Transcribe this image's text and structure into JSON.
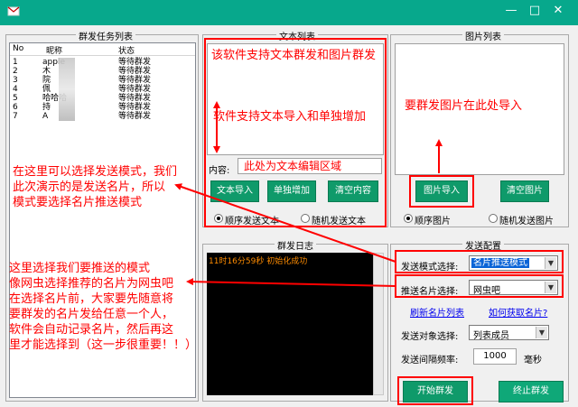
{
  "window": {
    "minimize": "—",
    "maximize": "□",
    "close": "✕"
  },
  "task_list": {
    "title": "群发任务列表",
    "columns": [
      "No",
      "昵称",
      "状态"
    ],
    "rows": [
      {
        "no": "1",
        "nick": "apple",
        "status": "等待群发"
      },
      {
        "no": "2",
        "nick": "木",
        "status": "等待群发"
      },
      {
        "no": "3",
        "nick": "院",
        "status": "等待群发"
      },
      {
        "no": "4",
        "nick": "佩",
        "status": "等待群发"
      },
      {
        "no": "5",
        "nick": "哈哈哈",
        "status": "等待群发"
      },
      {
        "no": "6",
        "nick": "持",
        "status": "等待群发"
      },
      {
        "no": "7",
        "nick": "A",
        "status": "等待群发"
      }
    ]
  },
  "text_list": {
    "title": "文本列表",
    "content": "该软件支持文本群发和图片群发",
    "content2": "软件支持文本导入和单独增加",
    "content_label": "内容:",
    "content_placeholder": "此处为文本编辑区域",
    "import_btn": "文本导入",
    "add_btn": "单独增加",
    "clear_btn": "清空内容",
    "radio_seq": "顺序发送文本",
    "radio_rand": "随机发送文本"
  },
  "image_list": {
    "title": "图片列表",
    "note": "要群发图片在此处导入",
    "import_btn": "图片导入",
    "clear_btn": "清空图片",
    "radio_seq": "顺序图片",
    "radio_rand": "随机发送图片"
  },
  "log": {
    "title": "群发日志",
    "entry": "11时16分59秒  初始化成功"
  },
  "config": {
    "title": "发送配置",
    "mode_label": "发送模式选择:",
    "mode_value": "名片推送模式",
    "card_label": "推送名片选择:",
    "card_value": "网虫吧",
    "refresh_link": "刷新名片列表",
    "howto_link": "如何获取名片?",
    "target_label": "发送对象选择:",
    "target_value": "列表成员",
    "freq_label": "发送间隔频率:",
    "freq_value": "1000",
    "freq_unit": "毫秒",
    "start_btn": "开始群发",
    "stop_btn": "终止群发"
  },
  "annotations": {
    "a1_line1": "在这里可以选择发送模式，我们",
    "a1_line2": "此次演示的是发送名片，所以",
    "a1_line3": "模式要选择名片推送模式",
    "a2_line1": "这里选择我们要推送的模式",
    "a2_line2": "像网虫选择推荐的名片为网虫吧",
    "a2_line3": "在选择名片前，大家要先随意将",
    "a2_line4": "要群发的名片发给任意一个人，",
    "a2_line5": "软件会自动记录名片，然后再这",
    "a2_line6": "里才能选择到（这一步很重要！！）"
  },
  "colors": {
    "titlebar": "#07a88c",
    "button_green": "#0f9a6a",
    "annotation_red": "#ff0000",
    "mode_highlight": "#0a64d7"
  }
}
